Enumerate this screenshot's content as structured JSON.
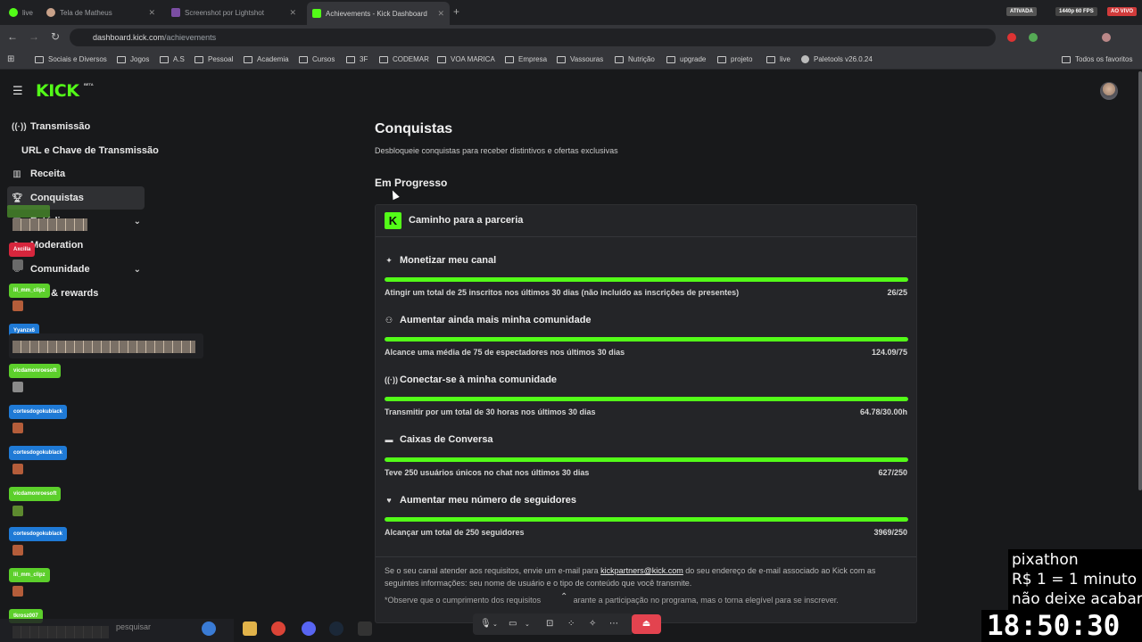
{
  "browser": {
    "tabs": [
      {
        "label": "live",
        "active": false
      },
      {
        "label": "Tela de Matheus",
        "active": false
      },
      {
        "label": "Screenshot por Lightshot",
        "active": false
      },
      {
        "label": "Achievements - Kick Dashboard",
        "active": true
      }
    ],
    "chips": {
      "ativada": "ATIVADA",
      "quality": "1440p 60 FPS",
      "aovivo": "AO VIVO"
    },
    "url_host": "dashboard.kick.com",
    "url_path": "/achievements",
    "bookmarks": [
      "Sociais e Diversos",
      "Jogos",
      "A.S",
      "Pessoal",
      "Academia",
      "Cursos",
      "3F",
      "CODEMAR",
      "VOA MARICA",
      "Empresa",
      "Vassouras",
      "Nutrição",
      "upgrade",
      "projeto",
      "live",
      "Paletools v26.0.24"
    ],
    "all_bookmarks": "Todos os favoritos"
  },
  "kick": {
    "logo": "KICK",
    "beta": "BETA"
  },
  "sidebar": {
    "items": [
      {
        "label": "Transmissão",
        "icon": "broadcast-icon"
      },
      {
        "label": "URL e Chave de Transmissão",
        "icon": ""
      },
      {
        "label": "Receita",
        "icon": "revenue-icon"
      },
      {
        "label": "Conquistas",
        "icon": "trophy-icon",
        "active": true
      },
      {
        "label": "Estúdio",
        "icon": "studio-icon",
        "expandable": true
      },
      {
        "label": "Moderation",
        "icon": "moderation-icon"
      },
      {
        "label": "Comunidade",
        "icon": "community-icon",
        "expandable": true
      },
      {
        "label": "s & rewards",
        "icon": "rewards-icon"
      }
    ]
  },
  "chat_overlay": {
    "users": [
      "Axcilla",
      "lil_mm_clipz",
      "Yyanzx6",
      "vicdamonroesoft",
      "cortesdogokublack",
      "cortesdogokublack",
      "vicdamonroesoft",
      "cortesdogokublack",
      "lil_mm_clipz",
      "tkrosz007"
    ]
  },
  "page": {
    "title": "Conquistas",
    "subtitle": "Desbloqueie conquistas para receber distintivos e ofertas exclusivas",
    "section": "Em Progresso",
    "card_title": "Caminho para a parceria",
    "goals": [
      {
        "title": "Monetizar meu canal",
        "icon": "sparkle-icon",
        "desc": "Atingir um total de 25 inscritos nos últimos 30 dias (não incluído as inscrições de presentes)",
        "value": "26/25",
        "progress": 1.0
      },
      {
        "title": "Aumentar ainda mais minha comunidade",
        "icon": "group-icon",
        "desc": "Alcance uma média de 75 de espectadores nos últimos 30 dias",
        "value": "124.09/75",
        "progress": 1.0
      },
      {
        "title": "Conectar-se à minha comunidade",
        "icon": "signal-icon",
        "desc": "Transmitir por um total de 30 horas nos últimos 30 dias",
        "value": "64.78/30.00h",
        "progress": 1.0
      },
      {
        "title": "Caixas de Conversa",
        "icon": "chat-icon",
        "desc": "Teve 250 usuários únicos no chat nos últimos 30 dias",
        "value": "627/250",
        "progress": 1.0
      },
      {
        "title": "Aumentar meu número de seguidores",
        "icon": "heart-icon",
        "desc": "Alcançar um total de 250 seguidores",
        "value": "3969/250",
        "progress": 1.0
      }
    ],
    "note_before": "Se o seu canal atender aos requisitos, envie um e-mail para ",
    "note_email": "kickpartners@kick.com",
    "note_after": " do seu endereço de e-mail associado ao Kick com as seguintes informações: seu nome de usuário e o tipo de conteúdo que você transmite.",
    "note2": "*Observe que o cumprimento dos requisitos",
    "note2b": "arante a participação no programa, mas o torna elegível para se inscrever."
  },
  "taskbar": {
    "search": "pesquisar"
  },
  "overlay": {
    "lines": [
      "pixathon",
      "R$ 1 = 1 minuto",
      "não deixe acabar"
    ],
    "clock": "18:50:30"
  },
  "colors": {
    "accent": "#53fc18",
    "background": "#18191b",
    "card": "#242528",
    "live_red": "#e3434f"
  }
}
